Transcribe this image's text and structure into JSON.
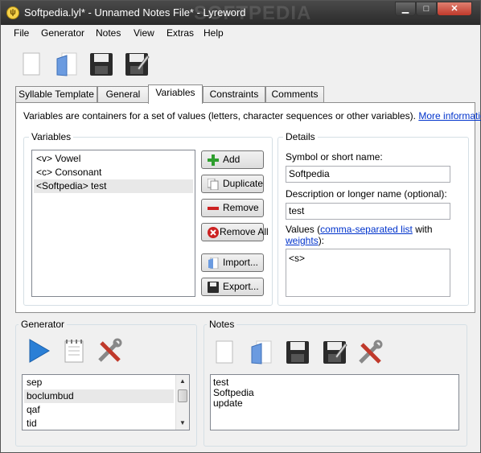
{
  "window": {
    "title": "Softpedia.lyl* - Unnamed Notes File* - Lyreword",
    "watermark": "SOFTPEDIA",
    "app_icon_glyph": "ψ"
  },
  "menu": [
    "File",
    "Generator",
    "Notes",
    "View",
    "Extras",
    "Help"
  ],
  "toolbar": [
    "new-file-icon",
    "open-file-icon",
    "save-icon",
    "save-as-icon"
  ],
  "tabs": [
    {
      "label": "Syllable Template"
    },
    {
      "label": "General"
    },
    {
      "label": "Variables",
      "active": true
    },
    {
      "label": "Constraints"
    },
    {
      "label": "Comments"
    }
  ],
  "variables_tab": {
    "description": "Variables are containers for a set of values (letters, character sequences or other variables).",
    "more_info_link": "More information",
    "variables_group_label": "Variables",
    "variables": [
      {
        "label": "<v> Vowel"
      },
      {
        "label": "<c> Consonant"
      },
      {
        "label": "<Softpedia> test",
        "selected": true
      }
    ],
    "buttons": {
      "add": "Add",
      "duplicate": "Duplicate",
      "remove": "Remove",
      "remove_all": "Remove All",
      "import": "Import...",
      "export": "Export..."
    },
    "details": {
      "group_label": "Details",
      "symbol_label": "Symbol or short name:",
      "symbol_value": "Softpedia",
      "description_label": "Description or longer name (optional):",
      "description_value": "test",
      "values_prefix": "Values (",
      "values_link1": "comma-separated list",
      "values_mid": " with",
      "values_link2": "weights",
      "values_suffix": "):",
      "values_value": "<s>"
    }
  },
  "generator": {
    "label": "Generator",
    "icons": [
      "play-icon",
      "notepad-icon",
      "tools-icon"
    ],
    "words": [
      "sep",
      "boclumbud",
      "qaf",
      "tid"
    ]
  },
  "notes": {
    "label": "Notes",
    "icons": [
      "new-file-icon",
      "open-file-icon",
      "save-icon",
      "save-as-icon",
      "tools-icon"
    ],
    "lines": [
      "test",
      "Softpedia",
      "update"
    ]
  },
  "colors": {
    "link": "#0033cc",
    "add_green": "#2e9e2e",
    "remove_red": "#cc2222"
  }
}
